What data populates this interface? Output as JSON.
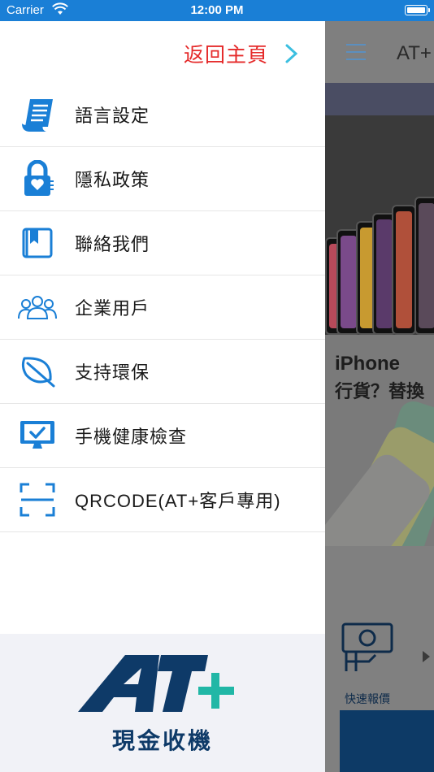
{
  "status_bar": {
    "carrier": "Carrier",
    "time": "12:00 PM"
  },
  "background": {
    "header_title": "AT+",
    "banner_title": "iPhone",
    "banner_subtitle": "行貨？替換",
    "quote_label": "快速報價"
  },
  "drawer": {
    "back_home_label": "返回主頁",
    "items": [
      {
        "label": "語言設定",
        "icon": "language-icon"
      },
      {
        "label": "隱私政策",
        "icon": "privacy-lock-icon"
      },
      {
        "label": "聯絡我們",
        "icon": "contact-book-icon"
      },
      {
        "label": "企業用戶",
        "icon": "business-users-icon"
      },
      {
        "label": "支持環保",
        "icon": "leaf-icon"
      },
      {
        "label": "手機健康檢查",
        "icon": "monitor-check-icon"
      },
      {
        "label": "QRCODE(AT+客戶專用)",
        "icon": "qr-scan-icon"
      }
    ],
    "logo_text": "AT+",
    "logo_subtitle": "現金收機"
  },
  "colors": {
    "status_bar": "#1a7fd6",
    "icon_blue": "#1a7fd6",
    "back_home_red": "#e52a2a",
    "chevron_cyan": "#3cbfe0",
    "logo_navy": "#0e3a68",
    "logo_teal": "#21b7a6"
  }
}
